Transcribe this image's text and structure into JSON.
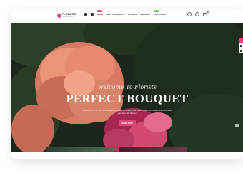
{
  "brand": {
    "name": "FLOWERS",
    "tagline": "FLOWER SHOP"
  },
  "nav": {
    "items": [
      {
        "label": "SHOP",
        "badge": "HOT",
        "badge_type": "hot"
      },
      {
        "label": "BEST SELLERS",
        "badge": "",
        "badge_type": ""
      },
      {
        "label": "OFFERS",
        "badge": "",
        "badge_type": ""
      },
      {
        "label": "BRANDS",
        "badge": "",
        "badge_type": ""
      },
      {
        "label": "FEATURES",
        "badge": "NEW",
        "badge_type": "new"
      }
    ]
  },
  "header": {
    "cart_count": "0"
  },
  "hero": {
    "script": "Welcome To Florists",
    "title": "PERFECT BOUQUET",
    "description": "A flower opens its heart without question, and a bird cannot live without love. Life is sweet when you share your love with flowers.",
    "button": "SHOP NOW"
  },
  "colors": {
    "accent": "#e0457b",
    "new_badge": "#6bbf59",
    "hero_bg": "#1c2a1c"
  }
}
